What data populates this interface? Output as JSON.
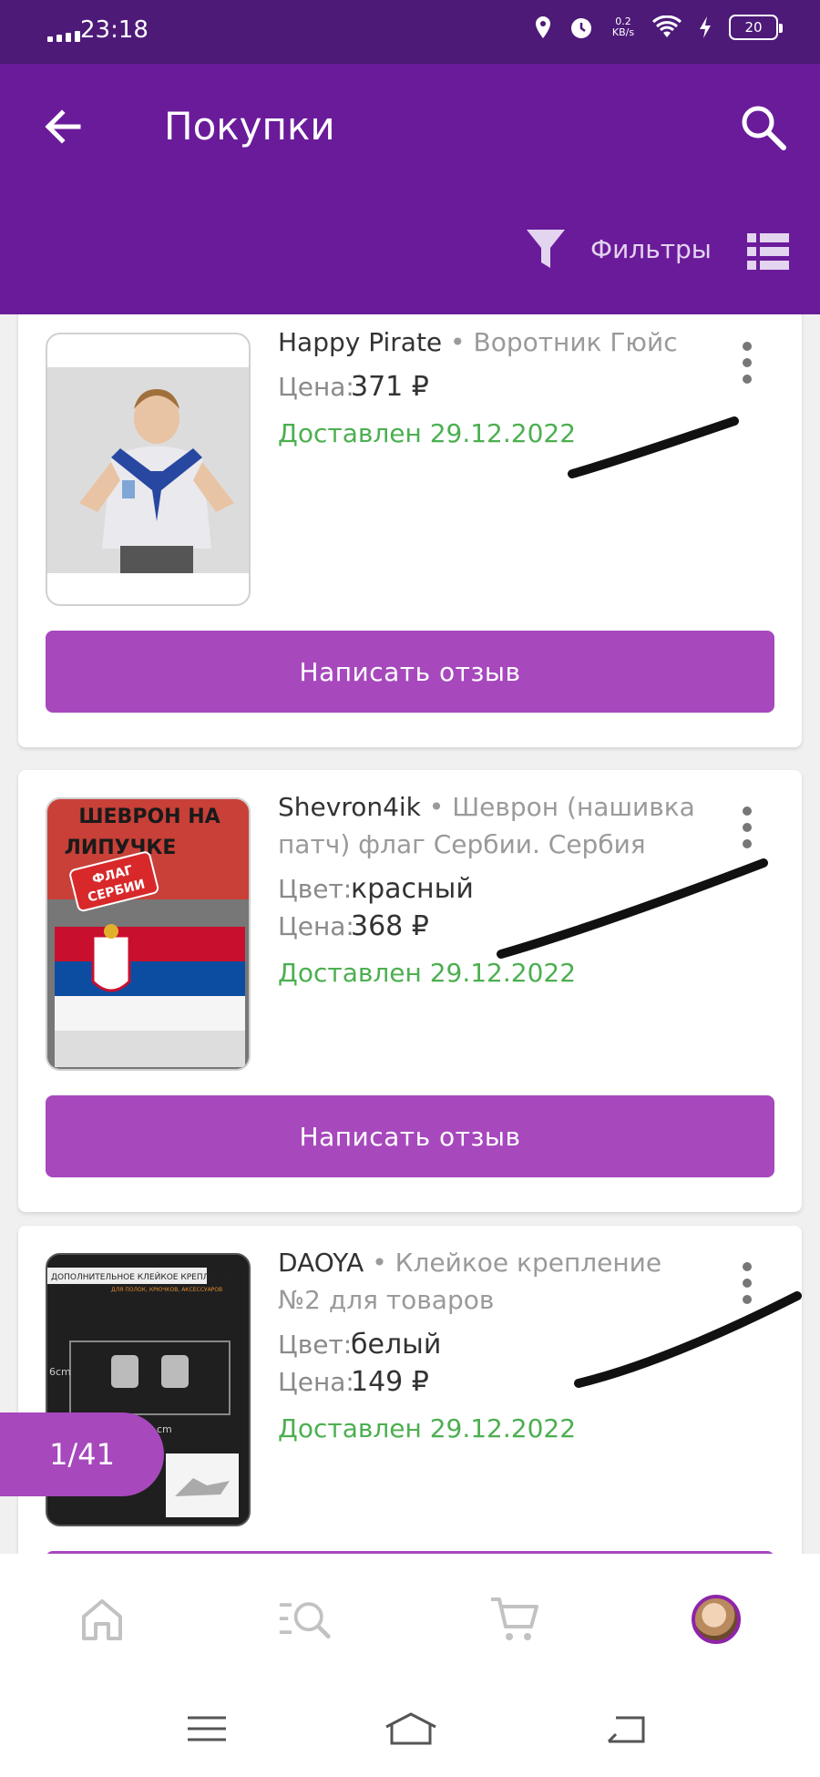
{
  "status_bar": {
    "time": "23:18",
    "net_speed_value": "0.2",
    "net_speed_unit": "KB/s",
    "battery": "20",
    "icons": [
      "signal-icon",
      "location-icon",
      "alarm-icon",
      "wifi-icon",
      "charging-icon",
      "battery-icon"
    ]
  },
  "header": {
    "title": "Покупки",
    "filters_label": "Фильтры",
    "icons": [
      "back-arrow-icon",
      "search-icon",
      "filter-icon",
      "list-view-icon"
    ]
  },
  "orders": [
    {
      "brand": "Happy Pirate",
      "separator": " • ",
      "product": "Воротник Гюйс",
      "color_label": "",
      "color_value": "",
      "price_label": "Цена:",
      "price": "371 ₽",
      "status": "Доставлен 29.12.2022",
      "review_button": "Написать отзыв"
    },
    {
      "brand": "Shevron4ik",
      "separator": " • ",
      "product": "Шеврон (нашивка патч) флаг Сербии. Сербия",
      "color_label": "Цвет:",
      "color_value": "красный",
      "price_label": "Цена:",
      "price": "368 ₽",
      "status": "Доставлен 29.12.2022",
      "review_button": "Написать отзыв",
      "image_text": [
        "ШЕВРОН НА",
        "ЛИПУЧКЕ",
        "ФЛАГ",
        "СЕРБИИ"
      ]
    },
    {
      "brand": "DAOYA",
      "separator": " • ",
      "product": "Клейкое крепление №2 для товаров",
      "color_label": "Цвет:",
      "color_value": "белый",
      "price_label": "Цена:",
      "price": "149 ₽",
      "status": "Доставлен 29.12.2022",
      "image_text": [
        "ДОПОЛНИТЕЛЬНОЕ КЛЕЙКОЕ КРЕПЛЕНИЕ",
        "ДЛЯ ПОЛОК, КРЮЧКОВ, АКСЕССУАРОВ",
        "6cm",
        "cm"
      ]
    }
  ],
  "page_indicator": "1/41",
  "bottom_nav": [
    "home-icon",
    "catalog-search-icon",
    "cart-icon",
    "profile-avatar"
  ],
  "system_nav": [
    "menu-icon",
    "home-icon",
    "back-icon"
  ],
  "colors": {
    "header": "#6a1b9a",
    "status_bar": "#4d1a78",
    "accent_button": "#a748bd",
    "delivered_text": "#4caf50"
  }
}
